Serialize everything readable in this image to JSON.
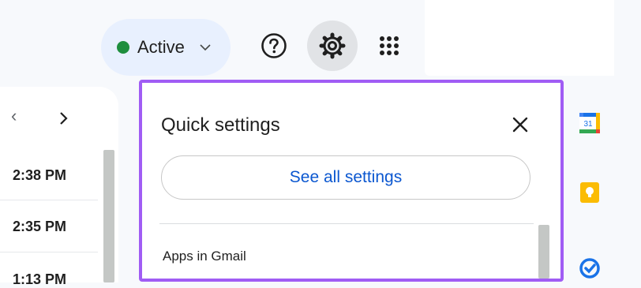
{
  "header": {
    "status_label": "Active"
  },
  "icons": {
    "status": "status-dot",
    "help": "help-icon",
    "settings": "gear-icon",
    "apps": "apps-grid-icon",
    "close": "close-icon",
    "calendar": "calendar-icon",
    "keep": "keep-icon",
    "tasks": "tasks-icon"
  },
  "colors": {
    "status_green": "#1e8e3e",
    "accent_blue": "#0b57d0",
    "highlight_purple": "#a05cf4"
  },
  "mail_list": {
    "times": [
      "2:38 PM",
      "2:35 PM",
      "1:13 PM"
    ]
  },
  "quick_settings": {
    "title": "Quick settings",
    "see_all_label": "See all settings",
    "section_label": "Apps in Gmail"
  },
  "side_panel": {
    "calendar_day": "31"
  }
}
